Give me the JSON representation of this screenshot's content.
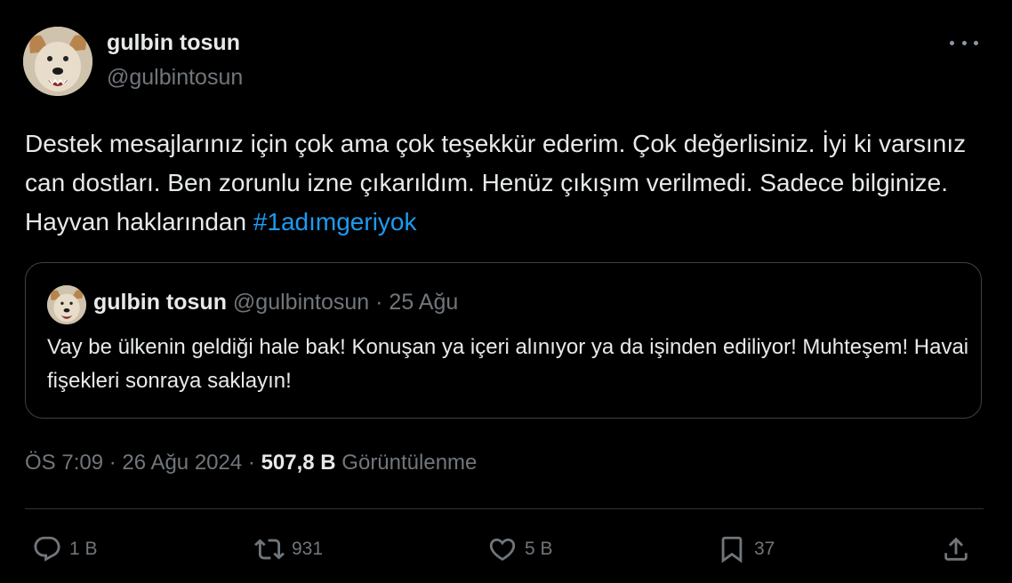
{
  "author": {
    "name": "gulbin tosun",
    "handle": "@gulbintosun"
  },
  "tweet": {
    "text": "Destek mesajlarınız için çok ama çok teşekkür ederim. Çok değerlisiniz. İyi ki varsınız can dostları. Ben zorunlu izne çıkarıldım. Henüz çıkışım verilmedi. Sadece bilginize. Hayvan haklarından ",
    "hashtag": "#1adımgeriyok"
  },
  "quote": {
    "name": "gulbin tosun",
    "handle": "@gulbintosun",
    "separator": "·",
    "date": "25 Ağu",
    "text": "Vay be ülkenin geldiği hale bak! Konuşan ya içeri alınıyor ya da işinden ediliyor! Muhteşem! Havai fişekleri sonraya saklayın!"
  },
  "meta": {
    "time": "ÖS 7:09",
    "separator1": "·",
    "date": "26 Ağu 2024",
    "separator2": "·",
    "views_count": "507,8 B",
    "views_label": "Görüntülenme"
  },
  "actions": {
    "replies": "1 B",
    "retweets": "931",
    "likes": "5 B",
    "bookmarks": "37"
  },
  "icons": {
    "more": "more-icon",
    "reply": "reply-icon",
    "retweet": "retweet-icon",
    "like": "like-icon",
    "bookmark": "bookmark-icon",
    "share": "share-icon"
  },
  "colors": {
    "background": "#000000",
    "text": "#e7e9ea",
    "secondary": "#71767b",
    "hashtag": "#1d9bf0",
    "border": "#2f3336"
  }
}
